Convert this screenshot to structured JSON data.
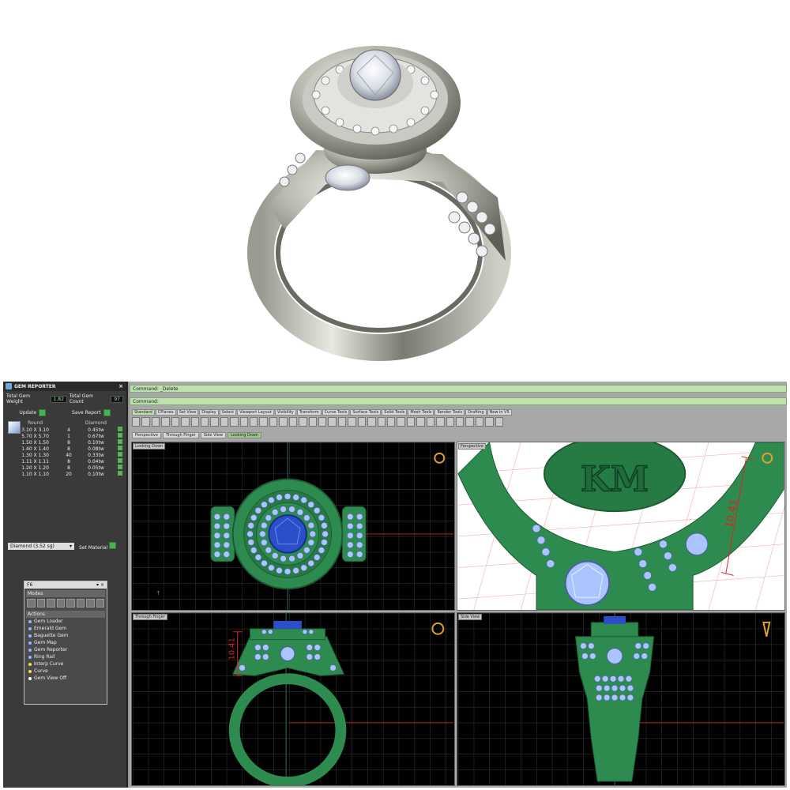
{
  "gem_reporter": {
    "title": "GEM REPORTER",
    "total_weight_label": "Total Gem Weight",
    "total_weight_value": "1.82",
    "total_count_label": "Total Gem Count",
    "total_count_value": "97",
    "update_label": "Update",
    "save_label": "Save Report",
    "col_shape": "Round",
    "col_material": "Diamond",
    "rows": [
      {
        "size": "3.10 X 3.10",
        "count": "4",
        "weight": "0.45tw"
      },
      {
        "size": "5.70 X 5.70",
        "count": "1",
        "weight": "0.67tw"
      },
      {
        "size": "1.50 X 1.50",
        "count": "8",
        "weight": "0.10tw"
      },
      {
        "size": "1.40 X 1.40",
        "count": "8",
        "weight": "0.08tw"
      },
      {
        "size": "1.30 X 1.30",
        "count": "40",
        "weight": "0.33tw"
      },
      {
        "size": "1.11 X 1.11",
        "count": "8",
        "weight": "0.04tw"
      },
      {
        "size": "1.20 X 1.20",
        "count": "8",
        "weight": "0.05tw"
      },
      {
        "size": "1.10 X 1.10",
        "count": "20",
        "weight": "0.10tw"
      }
    ],
    "material_select": "Diamond   (3.52 sg)",
    "set_material_label": "Set Material"
  },
  "f6": {
    "title": "F6",
    "modes_label": "Modes",
    "actions_label": "Actions",
    "actions": [
      "Gem Loader",
      "Emerald Gem",
      "Baguette Gem",
      "Gem Map",
      "Gem Reporter",
      "Ring Rail",
      "Interp Curve",
      "Curve",
      "Gem View Off"
    ]
  },
  "command": {
    "line1": "Command: _Delete",
    "line2": "Command:"
  },
  "toolbar_tabs": [
    "Standard",
    "CPlanes",
    "Set View",
    "Display",
    "Select",
    "Viewport Layout",
    "Visibility",
    "Transform",
    "Curve Tools",
    "Surface Tools",
    "Solid Tools",
    "Mesh Tools",
    "Render Tools",
    "Drafting",
    "New in V5"
  ],
  "viewport_tabs": [
    "Perspective",
    "Through Finger",
    "Side View",
    "Looking Down"
  ],
  "viewports": {
    "top_left": "Looking Down",
    "top_right": "Perspective",
    "bottom_left": "Through Finger",
    "bottom_right": "Side View"
  },
  "dimension_perspective": "10.41",
  "dimension_front": "10.41",
  "monogram": "KM",
  "colors": {
    "model_green": "#2e8b4f",
    "gem_blue": "#2a4fc8",
    "accent_stone": "#a9c4ff",
    "command_bar": "#bfe1b0"
  }
}
